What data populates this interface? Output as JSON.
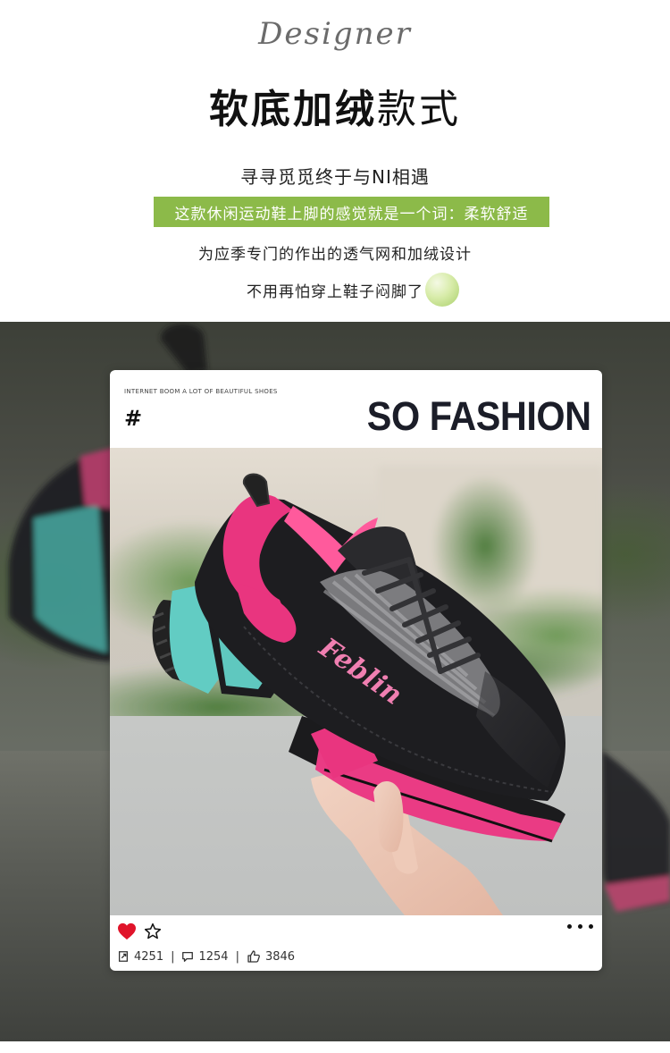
{
  "header": {
    "script_word": "Designer",
    "title_bold": "软底加绒",
    "title_regular": "款式",
    "line1": "寻寻觅觅终于与NI相遇",
    "highlight": "这款休闲运动鞋上脚的感觉就是一个词：柔软舒适",
    "line3": "为应季专门的作出的透气网和加绒设计",
    "line4": "不用再怕穿上鞋子闷脚了"
  },
  "card": {
    "small_caption": "INTERNET BOOM A LOT OF BEAUTIFUL SHOES",
    "hash": "#",
    "headline": "SO FASHION",
    "shoe_logo": "Feblin",
    "stats": {
      "shares": "4251",
      "comments": "1254",
      "likes": "3846"
    }
  },
  "colors": {
    "accent_green": "#8cba49",
    "heart_red": "#e0142a",
    "shoe_pink": "#e9357f",
    "shoe_teal": "#5ec9c0"
  },
  "icons": [
    "heart-icon",
    "star-icon",
    "more-dots-icon",
    "share-icon",
    "comment-icon",
    "thumbs-up-icon"
  ]
}
